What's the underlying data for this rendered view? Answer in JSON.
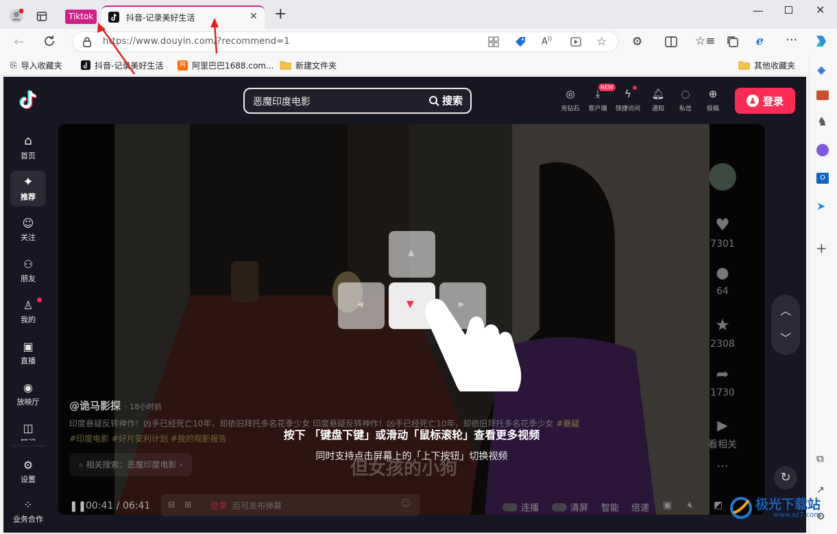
{
  "browser": {
    "tab_tag": "Tiktok",
    "tab_title": "抖音-记录美好生活",
    "url": "https://www.douyin.com/?recommend=1",
    "bookmarks": [
      "导入收藏夹",
      "抖音-记录美好生活",
      "阿里巴巴1688.com...",
      "新建文件夹"
    ],
    "other_bookmarks": "其他收藏夹"
  },
  "site": {
    "search_text": "恶魔印度电影",
    "search_button": "搜索",
    "top_icons": [
      "充钻石",
      "客户端",
      "快捷访问",
      "通知",
      "私信",
      "投稿"
    ],
    "new_badge": "NEW",
    "login": "登录",
    "nav": [
      "首页",
      "推荐",
      "关注",
      "朋友",
      "我的",
      "直播",
      "放映厅",
      "知识",
      "设置",
      "业务合作"
    ]
  },
  "video": {
    "author": "@诡马影探",
    "time": "· 18小时前",
    "desc": "印度悬疑反转神作！凶手已经死亡10年，却依旧拜托多名花季少女 印度悬疑反转神作！凶手已经死亡10年，却依旧拜托多名花季少女",
    "tag_inline": "#悬疑",
    "tags": "#印度电影 #好片安利计划 #我的观影报告",
    "related": "相关搜索：恶魔印度电影",
    "subtitle": "但女孩的小狗",
    "hint_line1": "按下 「键盘下键」或滑动「鼠标滚轮」查看更多视频",
    "hint_line2": "同时支持点击屏幕上的「上下按钮」切换视频",
    "likes": "7301",
    "comments": "64",
    "favorites": "2308",
    "shares": "1730",
    "related_label": "看相关",
    "time_current": "00:41",
    "time_total": "06:41",
    "danmaku_login": "登录",
    "danmaku_placeholder": "后可发布弹幕",
    "controls": [
      "连播",
      "清屏",
      "智能",
      "倍速"
    ]
  },
  "watermark": {
    "brand": "极光下载站",
    "url": "www.xz7.com"
  },
  "colors": {
    "accent": "#fe2c55",
    "tiktok_tag": "#d01f88",
    "arrow": "#e02020"
  }
}
